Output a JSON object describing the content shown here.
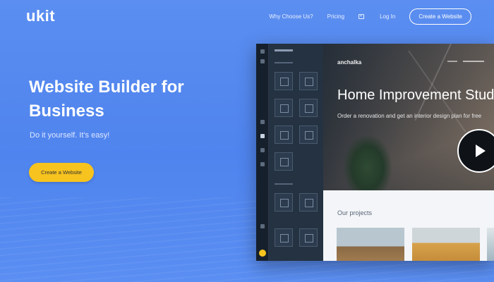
{
  "header": {
    "logo": "ukit",
    "nav": [
      "Why Choose Us?",
      "Pricing",
      "Log In"
    ],
    "cta": "Create a Website"
  },
  "hero": {
    "title": "Website Builder for Business",
    "subtitle": "Do it yourself. It's easy!",
    "button": "Create a Website"
  },
  "editor_preview": {
    "site_brand": "anchalka",
    "site_title": "Home Improvement Stud",
    "site_subtitle": "Order a renovation and get an interior design plan for free",
    "projects_heading": "Our projects"
  },
  "colors": {
    "background": "#5b8ef0",
    "accent": "#f7c31e",
    "editor_dark": "#1e2a38"
  }
}
